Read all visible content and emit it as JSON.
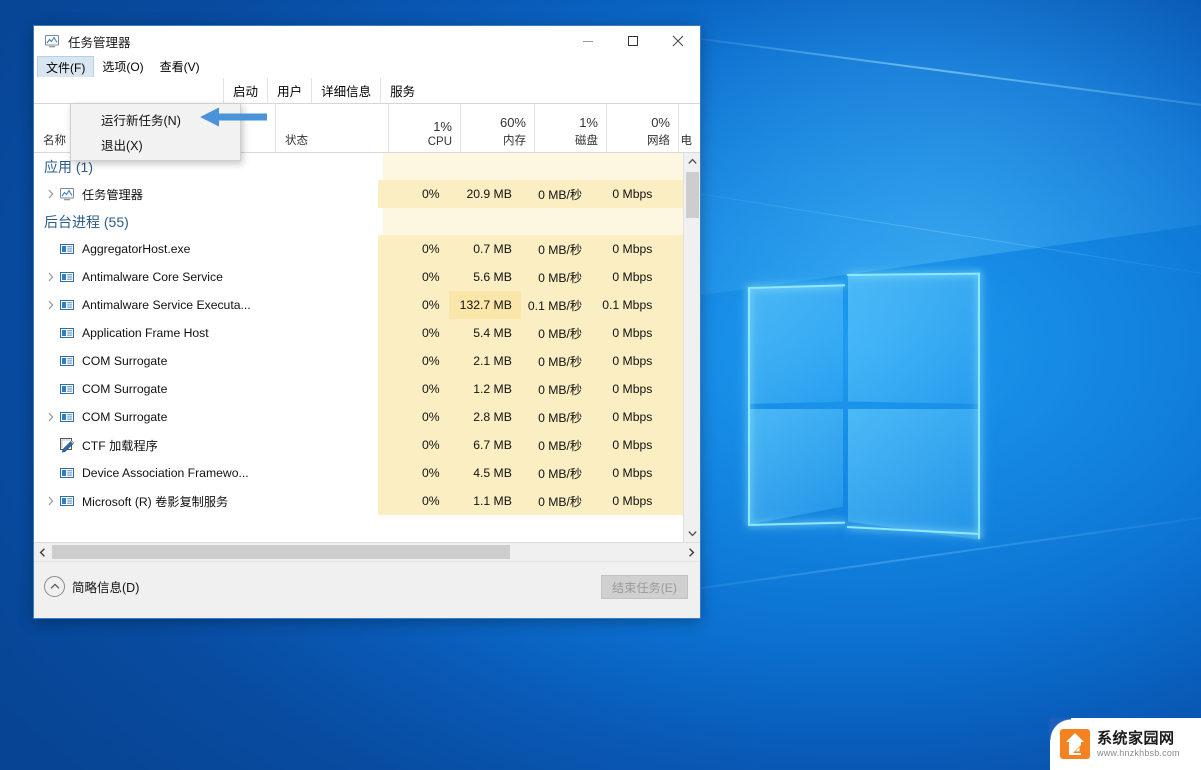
{
  "desktop": {
    "wallpaper_name": "windows-10-hero-wallpaper",
    "accent_color": "#0a63c4"
  },
  "watermark": {
    "title": "系统家园网",
    "url": "www.hnzkhbsb.com"
  },
  "window": {
    "title": "任务管理器",
    "icon": "task-manager-icon",
    "controls": {
      "minimize": "minimize-icon",
      "maximize": "maximize-icon",
      "close": "close-icon"
    }
  },
  "menubar": {
    "items": [
      {
        "label": "文件(F)",
        "active": true
      },
      {
        "label": "选项(O)",
        "active": false
      },
      {
        "label": "查看(V)",
        "active": false
      }
    ]
  },
  "dropdown": {
    "open_for": "文件(F)",
    "items": [
      {
        "label": "运行新任务(N)"
      },
      {
        "label": "退出(X)"
      }
    ]
  },
  "annotation": {
    "arrow": "left-pointing-arrow",
    "color": "#4a93d9",
    "points_at": "运行新任务(N)"
  },
  "tabs": [
    {
      "label": "启动",
      "partially_hidden": true
    },
    {
      "label": "用户"
    },
    {
      "label": "详细信息"
    },
    {
      "label": "服务"
    }
  ],
  "columns": [
    {
      "name": "名称",
      "pct": "",
      "align": "left"
    },
    {
      "name": "状态",
      "pct": "",
      "align": "left"
    },
    {
      "name": "CPU",
      "pct": "1%",
      "align": "right"
    },
    {
      "name": "内存",
      "pct": "60%",
      "align": "right"
    },
    {
      "name": "磁盘",
      "pct": "1%",
      "align": "right"
    },
    {
      "name": "网络",
      "pct": "0%",
      "align": "right"
    },
    {
      "name": "电",
      "pct": "",
      "align": "right"
    }
  ],
  "groups": [
    {
      "title": "应用 (1)"
    },
    {
      "title": "后台进程 (55)"
    }
  ],
  "rows": [
    {
      "kind": "group",
      "title": "应用 (1)"
    },
    {
      "kind": "process",
      "chevron": true,
      "icon": "task-manager-icon",
      "name": "任务管理器",
      "status": "",
      "cpu": "0%",
      "memory": "20.9 MB",
      "disk": "0 MB/秒",
      "network": "0 Mbps",
      "heat": {
        "cpu": 1,
        "memory": 1,
        "disk": 1,
        "network": 1
      }
    },
    {
      "kind": "group",
      "title": "后台进程 (55)"
    },
    {
      "kind": "process",
      "chevron": false,
      "icon": "generic-app-icon",
      "name": "AggregatorHost.exe",
      "status": "",
      "cpu": "0%",
      "memory": "0.7 MB",
      "disk": "0 MB/秒",
      "network": "0 Mbps",
      "heat": {
        "cpu": 1,
        "memory": 1,
        "disk": 1,
        "network": 1
      }
    },
    {
      "kind": "process",
      "chevron": true,
      "icon": "generic-app-icon",
      "name": "Antimalware Core Service",
      "status": "",
      "cpu": "0%",
      "memory": "5.6 MB",
      "disk": "0 MB/秒",
      "network": "0 Mbps",
      "heat": {
        "cpu": 1,
        "memory": 1,
        "disk": 1,
        "network": 1
      }
    },
    {
      "kind": "process",
      "chevron": true,
      "icon": "generic-app-icon",
      "name": "Antimalware Service Executa...",
      "status": "",
      "cpu": "0%",
      "memory": "132.7 MB",
      "disk": "0.1 MB/秒",
      "network": "0.1 Mbps",
      "heat": {
        "cpu": 1,
        "memory": 2,
        "disk": 1,
        "network": 1
      }
    },
    {
      "kind": "process",
      "chevron": false,
      "icon": "generic-app-icon",
      "name": "Application Frame Host",
      "status": "",
      "cpu": "0%",
      "memory": "5.4 MB",
      "disk": "0 MB/秒",
      "network": "0 Mbps",
      "heat": {
        "cpu": 1,
        "memory": 1,
        "disk": 1,
        "network": 1
      }
    },
    {
      "kind": "process",
      "chevron": false,
      "icon": "generic-app-icon",
      "name": "COM Surrogate",
      "status": "",
      "cpu": "0%",
      "memory": "2.1 MB",
      "disk": "0 MB/秒",
      "network": "0 Mbps",
      "heat": {
        "cpu": 1,
        "memory": 1,
        "disk": 1,
        "network": 1
      }
    },
    {
      "kind": "process",
      "chevron": false,
      "icon": "generic-app-icon",
      "name": "COM Surrogate",
      "status": "",
      "cpu": "0%",
      "memory": "1.2 MB",
      "disk": "0 MB/秒",
      "network": "0 Mbps",
      "heat": {
        "cpu": 1,
        "memory": 1,
        "disk": 1,
        "network": 1
      }
    },
    {
      "kind": "process",
      "chevron": true,
      "icon": "generic-app-icon",
      "name": "COM Surrogate",
      "status": "",
      "cpu": "0%",
      "memory": "2.8 MB",
      "disk": "0 MB/秒",
      "network": "0 Mbps",
      "heat": {
        "cpu": 1,
        "memory": 1,
        "disk": 1,
        "network": 1
      }
    },
    {
      "kind": "process",
      "chevron": false,
      "icon": "ctf-loader-icon",
      "name": "CTF 加载程序",
      "status": "",
      "cpu": "0%",
      "memory": "6.7 MB",
      "disk": "0 MB/秒",
      "network": "0 Mbps",
      "heat": {
        "cpu": 1,
        "memory": 1,
        "disk": 1,
        "network": 1
      }
    },
    {
      "kind": "process",
      "chevron": false,
      "icon": "generic-app-icon",
      "name": "Device Association Framewo...",
      "status": "",
      "cpu": "0%",
      "memory": "4.5 MB",
      "disk": "0 MB/秒",
      "network": "0 Mbps",
      "heat": {
        "cpu": 1,
        "memory": 1,
        "disk": 1,
        "network": 1
      }
    },
    {
      "kind": "process",
      "chevron": true,
      "icon": "generic-app-icon",
      "name": "Microsoft (R) 卷影复制服务",
      "status": "",
      "cpu": "0%",
      "memory": "1.1 MB",
      "disk": "0 MB/秒",
      "network": "0 Mbps",
      "heat": {
        "cpu": 1,
        "memory": 1,
        "disk": 1,
        "network": 1
      }
    }
  ],
  "footer": {
    "fewer_details_label": "简略信息(D)",
    "fewer_details_icon": "chevron-up-circle-icon",
    "end_task_label": "结束任务(E)",
    "end_task_enabled": false
  },
  "scrollbars": {
    "vertical_position": "near-top",
    "horizontal_position": "left"
  }
}
